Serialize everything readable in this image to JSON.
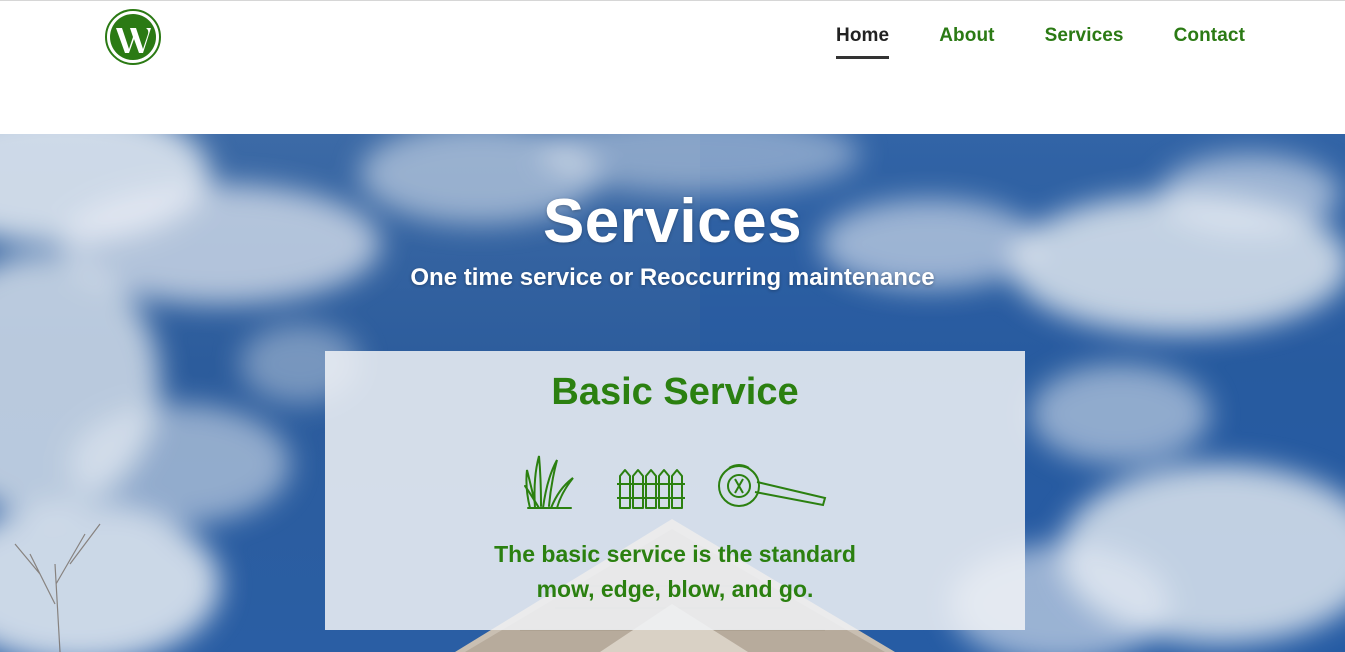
{
  "nav": {
    "items": [
      {
        "label": "Home",
        "active": true
      },
      {
        "label": "About",
        "active": false
      },
      {
        "label": "Services",
        "active": false
      },
      {
        "label": "Contact",
        "active": false
      }
    ]
  },
  "logo": {
    "icon": "wordpress-logo",
    "color": "#2b7a14"
  },
  "hero": {
    "title": "Services",
    "subtitle": "One time service or Reoccurring maintenance"
  },
  "card": {
    "title": "Basic Service",
    "icons": [
      "grass-icon",
      "fence-icon",
      "leaf-blower-icon"
    ],
    "description_line1": "The basic service is the standard",
    "description_line2": "mow, edge, blow, and go."
  },
  "colors": {
    "brand_green": "#2b8010",
    "nav_active": "#222222",
    "sky_blue": "#2c5c9c"
  }
}
